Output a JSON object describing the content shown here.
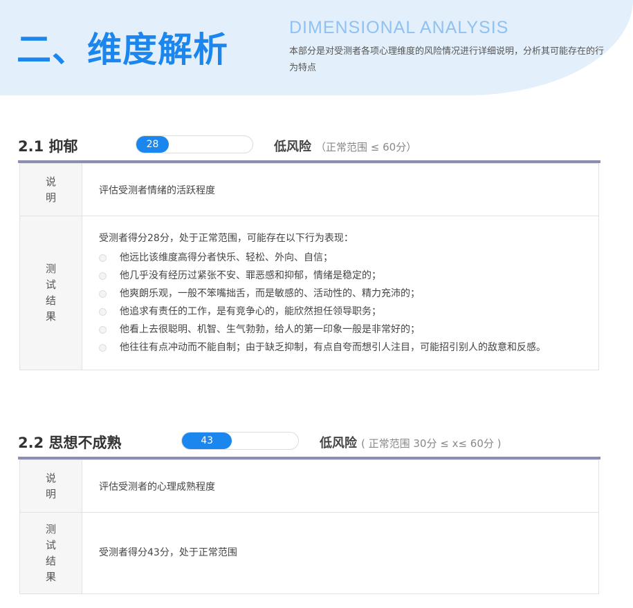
{
  "header": {
    "title": "二、维度解析",
    "subtitle_en": "DIMENSIONAL ANALYSIS",
    "description": "本部分是对受测者各项心理维度的风险情况进行详细说明，分析其可能存在的行为特点"
  },
  "sections": [
    {
      "title": "2.1 抑郁",
      "score": 28,
      "score_fraction": 0.28,
      "risk_level": "低风险",
      "risk_range": "（正常范围 ≤ 60分）",
      "desc_label": "说明",
      "desc_text": "评估受测者情绪的活跃程度",
      "result_label": "测试结果",
      "result_intro": "受测者得分28分，处于正常范围，可能存在以下行为表现：",
      "result_items": [
        "他远比该维度高得分者快乐、轻松、外向、自信；",
        "他几乎没有经历过紧张不安、罪恶感和抑郁，情绪是稳定的；",
        "他爽朗乐观，一般不笨嘴拙舌，而是敏感的、活动性的、精力充沛的；",
        "他追求有责任的工作，是有竞争心的，能欣然担任领导职务；",
        "他看上去很聪明、机智、生气勃勃，给人的第一印象一般是非常好的；",
        "他往往有点冲动而不能自制；由于缺乏抑制，有点自夸而想引人注目，可能招引别人的敌意和反感。"
      ]
    },
    {
      "title": "2.2 思想不成熟",
      "score": 43,
      "score_fraction": 0.43,
      "risk_level": "低风险",
      "risk_range": "( 正常范围 30分 ≤ x≤ 60分 )",
      "desc_label": "说明",
      "desc_text": "评估受测者的心理成熟程度",
      "result_label": "测试结果",
      "result_intro": "受测者得分43分，处于正常范围",
      "result_items": []
    }
  ],
  "colors": {
    "accent": "#1a86ee",
    "hero_bg": "#e3effb",
    "rule": "#8a8fb0"
  }
}
